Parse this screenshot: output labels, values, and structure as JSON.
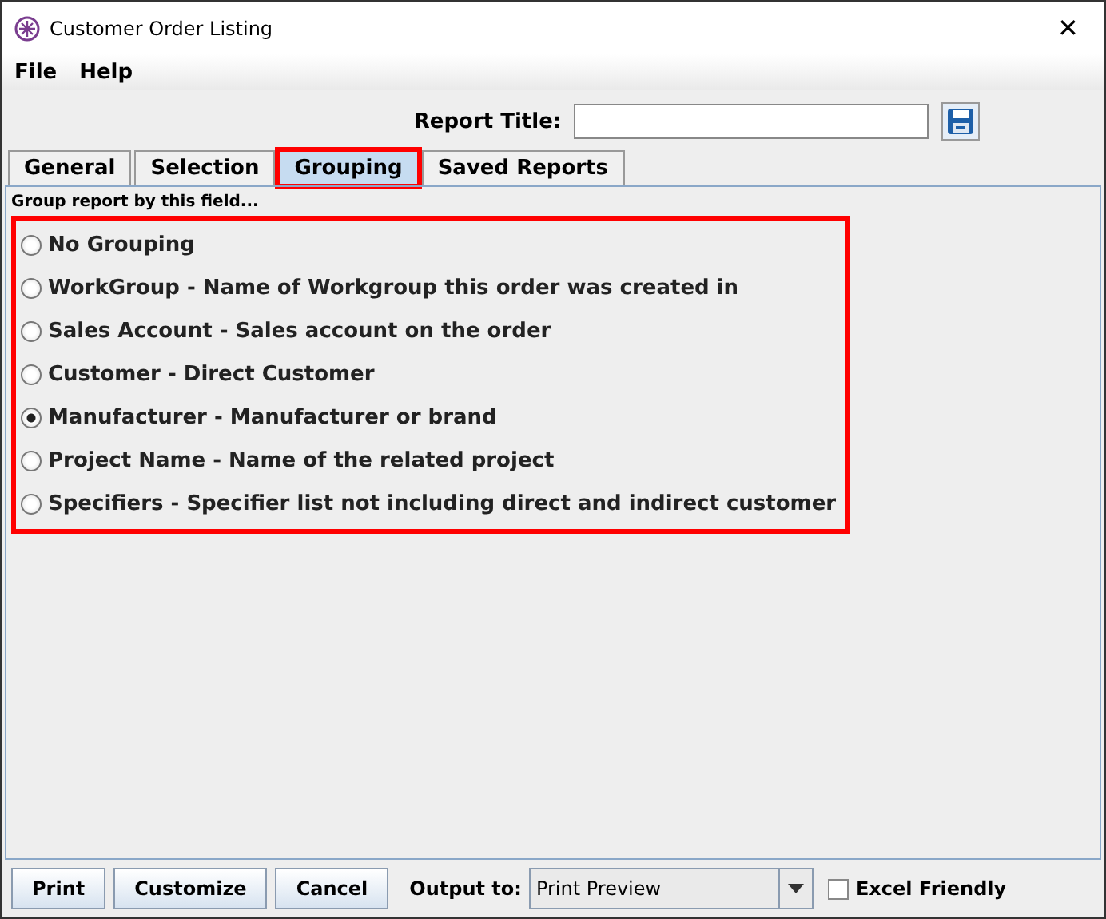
{
  "window": {
    "title": "Customer Order Listing",
    "close": "✕"
  },
  "menu": [
    "File",
    "Help"
  ],
  "report_title": {
    "label": "Report Title:"
  },
  "tabs": [
    {
      "label": "General",
      "selected": false,
      "highlighted": false
    },
    {
      "label": "Selection",
      "selected": false,
      "highlighted": false
    },
    {
      "label": "Grouping",
      "selected": true,
      "highlighted": true
    },
    {
      "label": "Saved Reports",
      "selected": false,
      "highlighted": false
    }
  ],
  "grouping": {
    "caption": "Group report by this field...",
    "highlighted": true,
    "options": [
      {
        "label": "No Grouping",
        "selected": false
      },
      {
        "label": "WorkGroup - Name of Workgroup this order was created in",
        "selected": false
      },
      {
        "label": "Sales Account - Sales account on the order",
        "selected": false
      },
      {
        "label": "Customer - Direct Customer",
        "selected": false
      },
      {
        "label": "Manufacturer - Manufacturer or brand",
        "selected": true
      },
      {
        "label": "Project Name - Name of the related project",
        "selected": false
      },
      {
        "label": "Specifiers - Specifier list not including direct and indirect customer",
        "selected": false
      }
    ]
  },
  "buttons": [
    "Print",
    "Customize",
    "Cancel"
  ],
  "output": {
    "label": "Output to:",
    "value": "Print Preview"
  },
  "excel_friendly": {
    "label": "Excel Friendly",
    "checked": false
  }
}
